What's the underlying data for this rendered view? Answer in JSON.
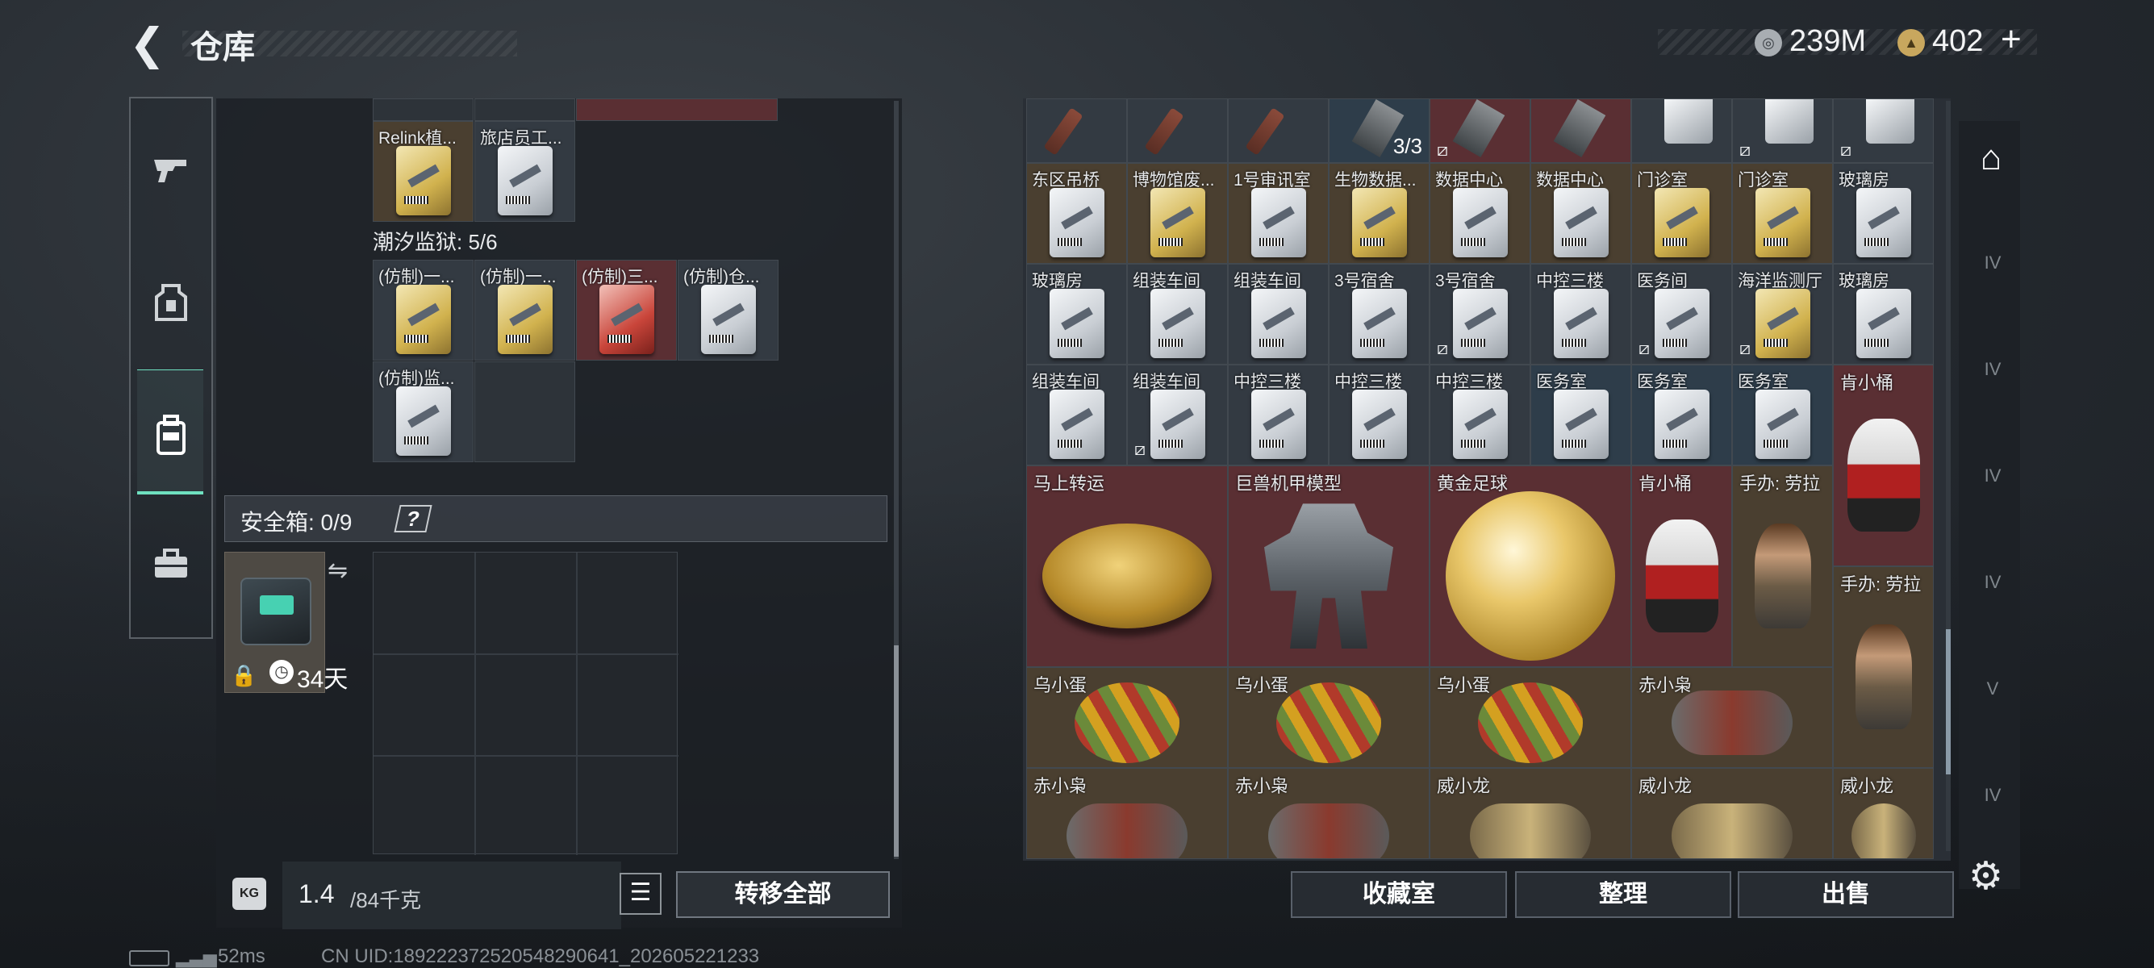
{
  "header": {
    "title": "仓库",
    "back_icon": "back-arrow-icon",
    "currency1": "239M",
    "currency2": "402",
    "plus": "+"
  },
  "left_nav": {
    "items": [
      "weapon-icon",
      "armor-icon",
      "backpack-icon",
      "toolbox-icon"
    ],
    "active": 2
  },
  "prison": {
    "label": "潮汐监狱: 5/6"
  },
  "top_items": [
    {
      "label": "Relink植..."
    },
    {
      "label": "旅店员工..."
    }
  ],
  "prison_items": [
    {
      "label": "(仿制)一..."
    },
    {
      "label": "(仿制)一..."
    },
    {
      "label": "(仿制)三..."
    },
    {
      "label": "(仿制)仓..."
    },
    {
      "label": "(仿制)监..."
    }
  ],
  "safe": {
    "label": "安全箱: 0/9",
    "help": "?",
    "days": "34天",
    "swap_icon": "swap-icon",
    "lock_icon": "lock-icon"
  },
  "weight": {
    "current": "1.4",
    "max": "/84千克",
    "kg_icon": "KG"
  },
  "transfer_all": "转移全部",
  "stash": {
    "stack_count": "3/3",
    "row1": [
      "东区吊桥",
      "博物馆废...",
      "1号审讯室",
      "生物数据...",
      "数据中心",
      "数据中心",
      "门诊室",
      "门诊室",
      "玻璃房"
    ],
    "row2": [
      "玻璃房",
      "组装车间",
      "组装车间",
      "3号宿舍",
      "3号宿舍",
      "中控三楼",
      "医务间",
      "海洋监测厅",
      "玻璃房"
    ],
    "row3": [
      "组装车间",
      "组装车间",
      "中控三楼",
      "中控三楼",
      "中控三楼",
      "医务室",
      "医务室",
      "医务室",
      "肯小桶"
    ],
    "big": {
      "horse": "马上转运",
      "mech": "巨兽机甲模型",
      "ball": "黄金足球",
      "kfc": "肯小桶",
      "lara1": "手办: 劳拉",
      "lara2": "手办: 劳拉",
      "egg1": "乌小蛋",
      "egg2": "乌小蛋",
      "egg3": "乌小蛋",
      "chi1": "赤小枭",
      "chi2": "赤小枭",
      "chi3": "赤小枭",
      "wei1": "威小龙",
      "wei2": "威小龙",
      "wei3": "威小龙"
    }
  },
  "buttons": {
    "collection": "收藏室",
    "organize": "整理",
    "sell": "出售"
  },
  "right_tabs": [
    "IV",
    "IV",
    "IV",
    "IV",
    "V",
    "IV"
  ],
  "status": {
    "ping": "52ms",
    "uid": "CN UID:189222372520548290641_202605221233"
  }
}
